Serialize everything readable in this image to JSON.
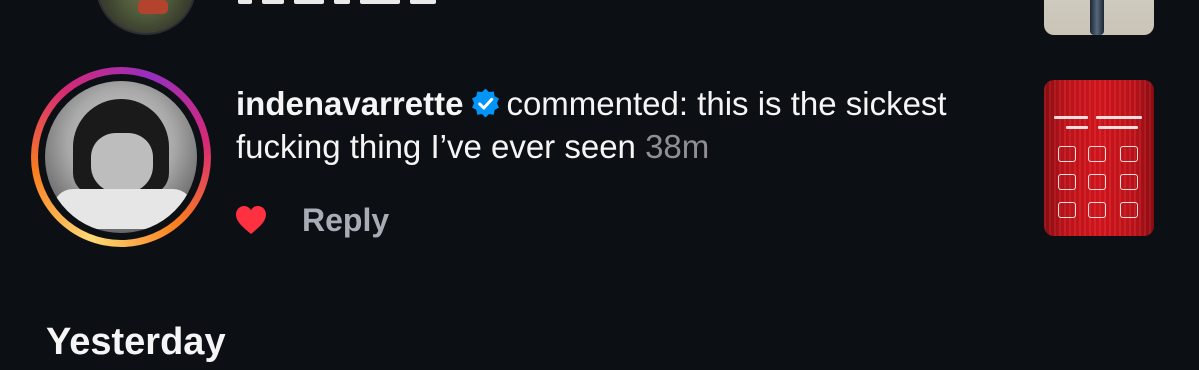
{
  "previous_item": {
    "avatar_icon": "avatar",
    "thumbnail_icon": "post-thumbnail"
  },
  "notification": {
    "username": "indenavarrette",
    "verified_icon": "verified-badge-icon",
    "message": "commented: this is the sickest fucking thing I’ve ever seen",
    "time": "38m",
    "liked": true,
    "reply_label": "Reply",
    "colors": {
      "story_ring": [
        "#feda75",
        "#fa7e1e",
        "#d62976",
        "#962fbf"
      ],
      "verified": "#0095f6",
      "heart": "#ff3040",
      "background": "#0c1014"
    }
  },
  "section": {
    "title": "Yesterday"
  }
}
